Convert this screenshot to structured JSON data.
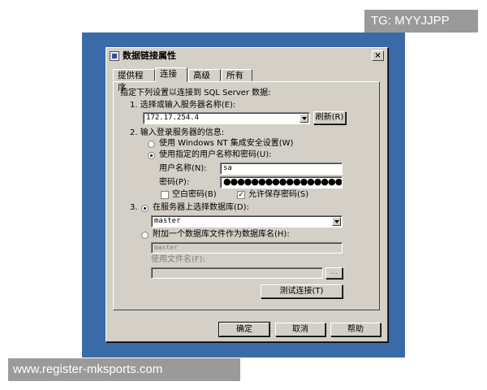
{
  "watermark_top": "TG: MYYJJPP",
  "watermark_bottom": "www.register-mksports.com",
  "dialog": {
    "title": "数据链接属性",
    "close_glyph": "×",
    "tabs": [
      "提供程序",
      "连接",
      "高级",
      "所有"
    ],
    "active_tab": "连接"
  },
  "connection": {
    "intro": "指定下列设置以连接到 SQL Server 数据:",
    "step1_label": "1. 选择或输入服务器名称(E):",
    "server_value": "172.17.254.4",
    "refresh_label": "刷新(R)",
    "step2_label": "2. 输入登录服务器的信息:",
    "option_nt_security": "使用 Windows NT 集成安全设置(W)",
    "option_user_password": "使用指定的用户名称和密码(U):",
    "username_label": "用户名称(N):",
    "username_value": "sa",
    "password_label": "密码(P):",
    "password_value": "●●●●●●●●●●●●●●●●●",
    "blank_password_label": "空白密码(B)",
    "blank_password_checked": false,
    "save_password_label": "允许保存密码(S)",
    "save_password_checked": true,
    "step3_label": "3.",
    "option_select_db": "在服务器上选择数据库(D):",
    "database_value": "master",
    "option_attach_db": "附加一个数据库文件作为数据库名(H):",
    "attach_db_value": "master",
    "use_filename_label": "使用文件名(F):",
    "filename_value": "",
    "browse_label": "...",
    "test_connection_label": "测试连接(T)"
  },
  "footer": {
    "ok_label": "确定",
    "cancel_label": "取消",
    "help_label": "帮助"
  },
  "colors": {
    "desktop": "#3a6aa8",
    "dialog_face": "#d4d0c8",
    "watermark_bg": "#9a9a9a"
  }
}
